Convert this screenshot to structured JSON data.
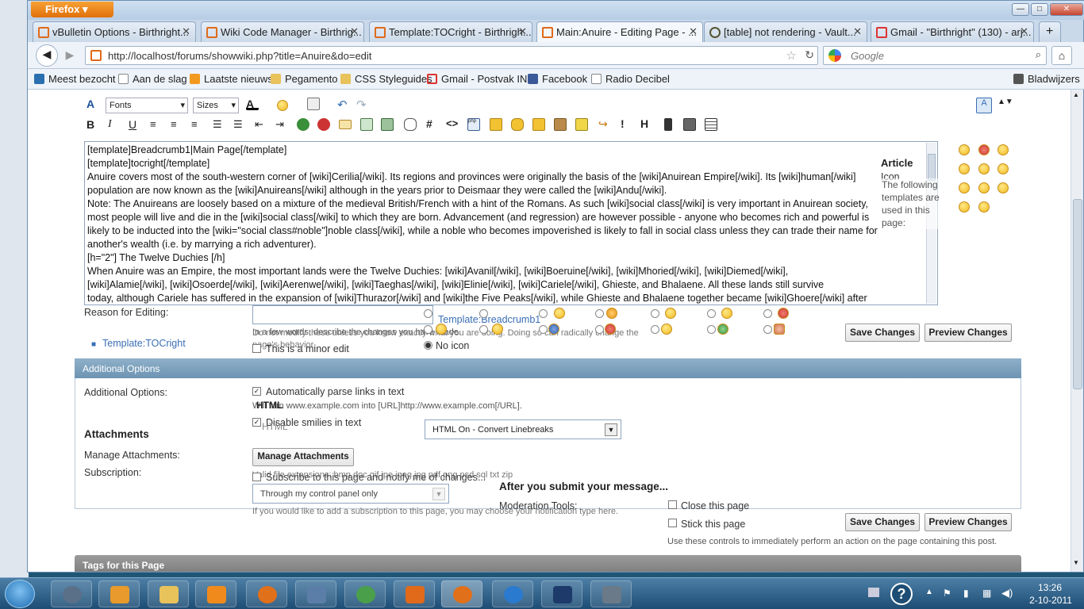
{
  "browser": {
    "app_button": "Firefox",
    "window_controls": {
      "minimize": "—",
      "maximize": "□",
      "close": "✕"
    },
    "tabs": [
      {
        "label": "vBulletin Options - Birthright...",
        "active": false
      },
      {
        "label": "Wiki Code Manager - Birthrig...",
        "active": false
      },
      {
        "label": "Template:TOCright - Birthrigh...",
        "active": false
      },
      {
        "label": "Main:Anuire - Editing Page - ...",
        "active": true
      },
      {
        "label": "[table] not rendering - Vault...",
        "active": false
      },
      {
        "label": "Gmail - \"Birthright\" (130) - arj...",
        "active": false
      }
    ],
    "new_tab": "+",
    "url": "http://localhost/forums/showwiki.php?title=Anuire&do=edit",
    "search_placeholder": "Google",
    "bookmarks": [
      "Meest bezocht",
      "Aan de slag",
      "Laatste nieuws",
      "Pegamento",
      "CSS Styleguides",
      "Gmail - Postvak IN",
      "Facebook",
      "Radio Decibel"
    ],
    "bookmarks_menu": "Bladwijzers"
  },
  "toolbar": {
    "fonts": "Fonts",
    "sizes": "Sizes"
  },
  "editor": {
    "lines": [
      "[template]Breadcrumb1|Main Page[/template]",
      "[template]tocright[/template]",
      "Anuire covers most of the south-western corner of [wiki]Cerilia[/wiki]. Its regions and provinces were originally the basis of the [wiki]Anuirean Empire[/wiki]. Its [wiki]human[/wiki]",
      "population are now known as the [wiki]Anuireans[/wiki] although in the years prior to Deismaar they were called the [wiki]Andu[/wiki].",
      "Note: The Anuireans are loosely based on a mixture of the medieval British/French with a hint of the Romans. As such [wiki]social class[/wiki] is very important in Anuirean society,",
      "most people will live and die in the [wiki]social class[/wiki] to which they are born. Advancement (and regression) are however possible - anyone who becomes rich and powerful is",
      "likely to be inducted into the [wiki=\"social class#noble\"]noble class[/wiki], while a noble who becomes impoverished is likely to fall in social class unless they can trade their name for",
      "another's wealth (i.e. by marrying a rich adventurer).",
      "[h=\"2\"] The Twelve Duchies [/h]",
      "When Anuire was an Empire, the most important lands were the Twelve Duchies: [wiki]Avanil[/wiki], [wiki]Boeruine[/wiki], [wiki]Mhoried[/wiki], [wiki]Diemed[/wiki],",
      "[wiki]Alamie[/wiki], [wiki]Osoerde[/wiki], [wiki]Aerenwe[/wiki], [wiki]Taeghas[/wiki], [wiki]Elinie[/wiki], [wiki]Cariele[/wiki], Ghieste, and Bhalaene. All these lands still survive",
      "today, although Cariele has suffered in the expansion of [wiki]Thurazor[/wiki] and [wiki]the Five Peaks[/wiki], while Ghieste and Bhalaene together became [wiki]Ghoere[/wiki] after"
    ]
  },
  "side_panel": {
    "title": "Article",
    "truncated": "Icon",
    "text": "The following templates are used in this page:"
  },
  "form": {
    "reason_label": "Reason for Editing:",
    "reason_hint": "In a few words, describe the changes you have made.",
    "overlap_hint": "Do not modify these unless you know exactly what you are doing. Doing so can radically change the page's behavior.",
    "minor_edit": "This is a minor edit",
    "template_link": "Template:TOCright",
    "template_link2": "Template:Breadcrumb1",
    "no_icon": "No icon",
    "save": "Save Changes",
    "preview": "Preview Changes"
  },
  "additional": {
    "header": "Additional Options",
    "label": "Additional Options:",
    "parse_links": "Automatically parse links in text",
    "parse_hint": "Will turn www.example.com into [URL]http://www.example.com[/URL].",
    "html_label": "HTML",
    "html_sub": "HTML",
    "disable_smilies": "Disable smilies in text",
    "html_select": "HTML On - Convert Linebreaks",
    "attachments_title": "Attachments",
    "manage_label": "Manage Attachments:",
    "manage_button": "Manage Attachments",
    "valid_ext": "Valid file extensions: bmp doc gif jpe jpeg jpg pdf png psd sql txt zip",
    "subscription_label": "Subscription:",
    "subscribe_check": "Subscribe to this page and notify me of changes...",
    "subscription_select": "Through my control panel only",
    "subscription_hint": "If you would like to add a subscription to this page, you may choose your notification type here.",
    "after_submit": "After you submit your message...",
    "moderation_label": "Moderation Tools:",
    "close_page": "Close this page",
    "stick_page": "Stick this page",
    "moderation_hint": "Use these controls to immediately perform an action on the page containing this post.",
    "tags_header": "Tags for this Page"
  },
  "taskbar": {
    "time": "13:26",
    "date": "2-10-2011"
  },
  "colors": {
    "accent": "#e0700a",
    "section": "#7b9fbd"
  }
}
